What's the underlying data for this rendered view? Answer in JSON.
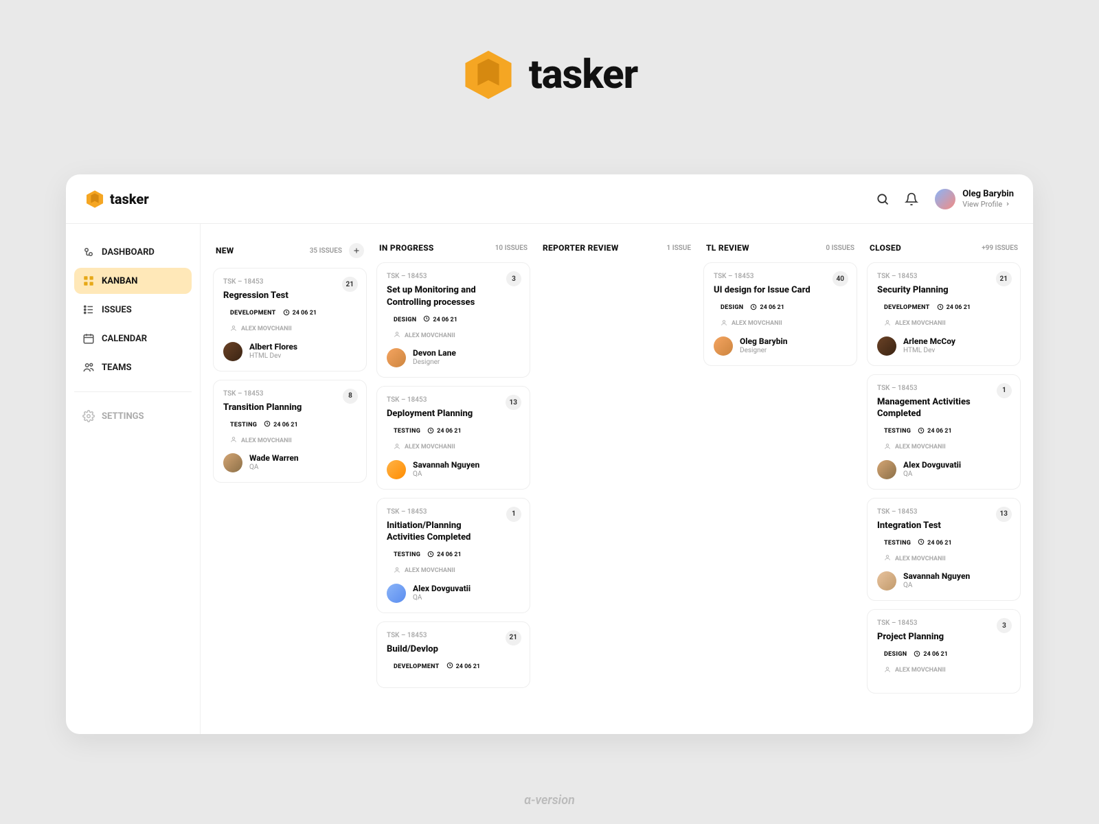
{
  "brand": {
    "name": "tasker"
  },
  "footer": "α-version",
  "header": {
    "user_name": "Oleg Barybin",
    "view_profile": "View Profile"
  },
  "sidebar": {
    "items": [
      {
        "label": "DASHBOARD",
        "icon": "dashboard"
      },
      {
        "label": "KANBAN",
        "icon": "kanban",
        "active": true
      },
      {
        "label": "ISSUES",
        "icon": "issues"
      },
      {
        "label": "CALENDAR",
        "icon": "calendar"
      },
      {
        "label": "TEAMS",
        "icon": "teams"
      }
    ],
    "settings_label": "SETTINGS"
  },
  "columns": [
    {
      "title": "NEW",
      "count": "35 ISSUES",
      "add": true,
      "cards": [
        {
          "id": "TSK – 18453",
          "title": "Regression Test",
          "tag": "DEVELOPMENT",
          "date": "24 06 21",
          "reporter": "ALEX MOVCHANII",
          "badge": "21",
          "assignee": {
            "name": "Albert Flores",
            "role": "HTML Dev"
          }
        },
        {
          "id": "TSK – 18453",
          "title": "Transition Planning",
          "tag": "TESTING",
          "date": "24 06 21",
          "reporter": "ALEX MOVCHANII",
          "badge": "8",
          "assignee": {
            "name": "Wade Warren",
            "role": "QA"
          }
        }
      ]
    },
    {
      "title": "IN PROGRESS",
      "count": "10 ISSUES",
      "cards": [
        {
          "id": "TSK – 18453",
          "title": "Set up Monitoring and Controlling processes",
          "tag": "DESIGN",
          "date": "24 06 21",
          "reporter": "ALEX MOVCHANII",
          "badge": "3",
          "assignee": {
            "name": "Devon Lane",
            "role": "Designer"
          }
        },
        {
          "id": "TSK – 18453",
          "title": "Deployment Planning",
          "tag": "TESTING",
          "date": "24 06 21",
          "reporter": "ALEX MOVCHANII",
          "badge": "13",
          "assignee": {
            "name": "Savannah Nguyen",
            "role": "QA"
          }
        },
        {
          "id": "TSK – 18453",
          "title": "Initiation/Planning Activities Completed",
          "tag": "TESTING",
          "date": "24 06 21",
          "reporter": "ALEX MOVCHANII",
          "badge": "1",
          "assignee": {
            "name": "Alex Dovguvatii",
            "role": "QA"
          }
        },
        {
          "id": "TSK – 18453",
          "title": "Build/Devlop",
          "tag": "DEVELOPMENT",
          "date": "24 06 21",
          "reporter": "",
          "badge": "21",
          "assignee": null
        }
      ]
    },
    {
      "title": "REPORTER REVIEW",
      "count": "1 ISSUE",
      "cards": []
    },
    {
      "title": "TL REVIEW",
      "count": "0 ISSUES",
      "cards": [
        {
          "id": "TSK – 18453",
          "title": "UI design for Issue Card",
          "tag": "DESIGN",
          "date": "24 06 21",
          "reporter": "ALEX MOVCHANII",
          "badge": "40",
          "assignee": {
            "name": "Oleg Barybin",
            "role": "Designer"
          }
        }
      ]
    },
    {
      "title": "CLOSED",
      "count": "+99 ISSUES",
      "cards": [
        {
          "id": "TSK – 18453",
          "title": "Security Planning",
          "tag": "DEVELOPMENT",
          "date": "24 06 21",
          "reporter": "ALEX MOVCHANII",
          "badge": "21",
          "assignee": {
            "name": "Arlene McCoy",
            "role": "HTML Dev"
          }
        },
        {
          "id": "TSK – 18453",
          "title": "Management Activities Completed",
          "tag": "TESTING",
          "date": "24 06 21",
          "reporter": "ALEX MOVCHANII",
          "badge": "1",
          "assignee": {
            "name": "Alex Dovguvatii",
            "role": "QA"
          }
        },
        {
          "id": "TSK – 18453",
          "title": "Integration Test",
          "tag": "TESTING",
          "date": "24 06 21",
          "reporter": "ALEX MOVCHANII",
          "badge": "13",
          "assignee": {
            "name": "Savannah Nguyen",
            "role": "QA"
          }
        },
        {
          "id": "TSK – 18453",
          "title": "Project Planning",
          "tag": "DESIGN",
          "date": "24 06 21",
          "reporter": "ALEX MOVCHANII",
          "badge": "3",
          "assignee": null
        }
      ]
    }
  ]
}
